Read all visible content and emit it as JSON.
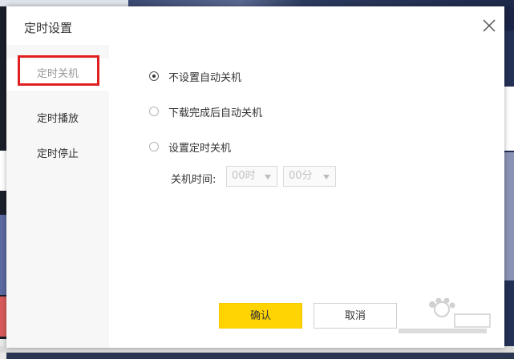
{
  "dialog": {
    "title": "定时设置",
    "close_icon": "close-icon"
  },
  "sidebar": {
    "items": [
      {
        "label": "定时关机",
        "active": true
      },
      {
        "label": "定时播放",
        "active": false
      },
      {
        "label": "定时停止",
        "active": false
      }
    ]
  },
  "options": [
    {
      "label": "不设置自动关机",
      "checked": true
    },
    {
      "label": "下载完成后自动关机",
      "checked": false
    },
    {
      "label": "设置定时关机",
      "checked": false
    }
  ],
  "shutdown_time": {
    "label": "关机时间:",
    "hour_value": "00时",
    "minute_value": "00分"
  },
  "buttons": {
    "confirm": "确认",
    "cancel": "取消"
  },
  "colors": {
    "accent": "#ffd400",
    "highlight": "#e02020"
  }
}
